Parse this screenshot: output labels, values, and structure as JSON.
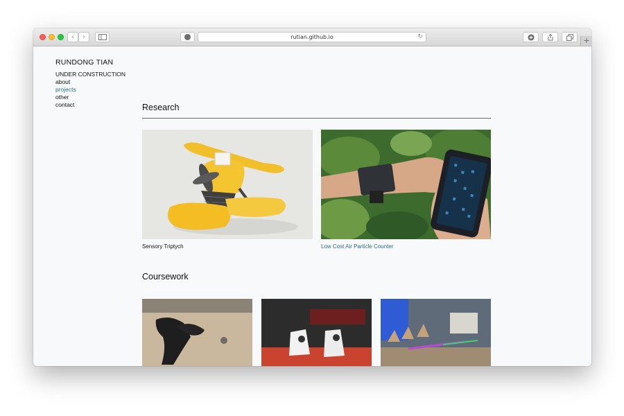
{
  "browser": {
    "url": "rutian.github.io",
    "back_icon": "chevron-left-icon",
    "forward_icon": "chevron-right-icon",
    "sidebar_icon": "sidebar-icon",
    "rss_icon": "reader-icon",
    "reload_icon": "reload-icon",
    "download_icon": "download-icon",
    "share_icon": "share-icon",
    "tabs_icon": "tabs-icon",
    "new_tab_label": "+"
  },
  "site": {
    "title": "RUNDONG TIAN",
    "nav": {
      "status": "UNDER CONSTRUCTION",
      "items": [
        "about",
        "projects",
        "other",
        "contact"
      ],
      "active": "projects"
    }
  },
  "research": {
    "heading": "Research",
    "projects": [
      {
        "caption": "Sensory Triptych"
      },
      {
        "caption": "Low Cost Air Particle Counter"
      }
    ]
  },
  "coursework": {
    "heading": "Coursework"
  },
  "colors": {
    "link": "#2b6f87",
    "page_bg": "#f8f9fb",
    "text": "#111111"
  }
}
